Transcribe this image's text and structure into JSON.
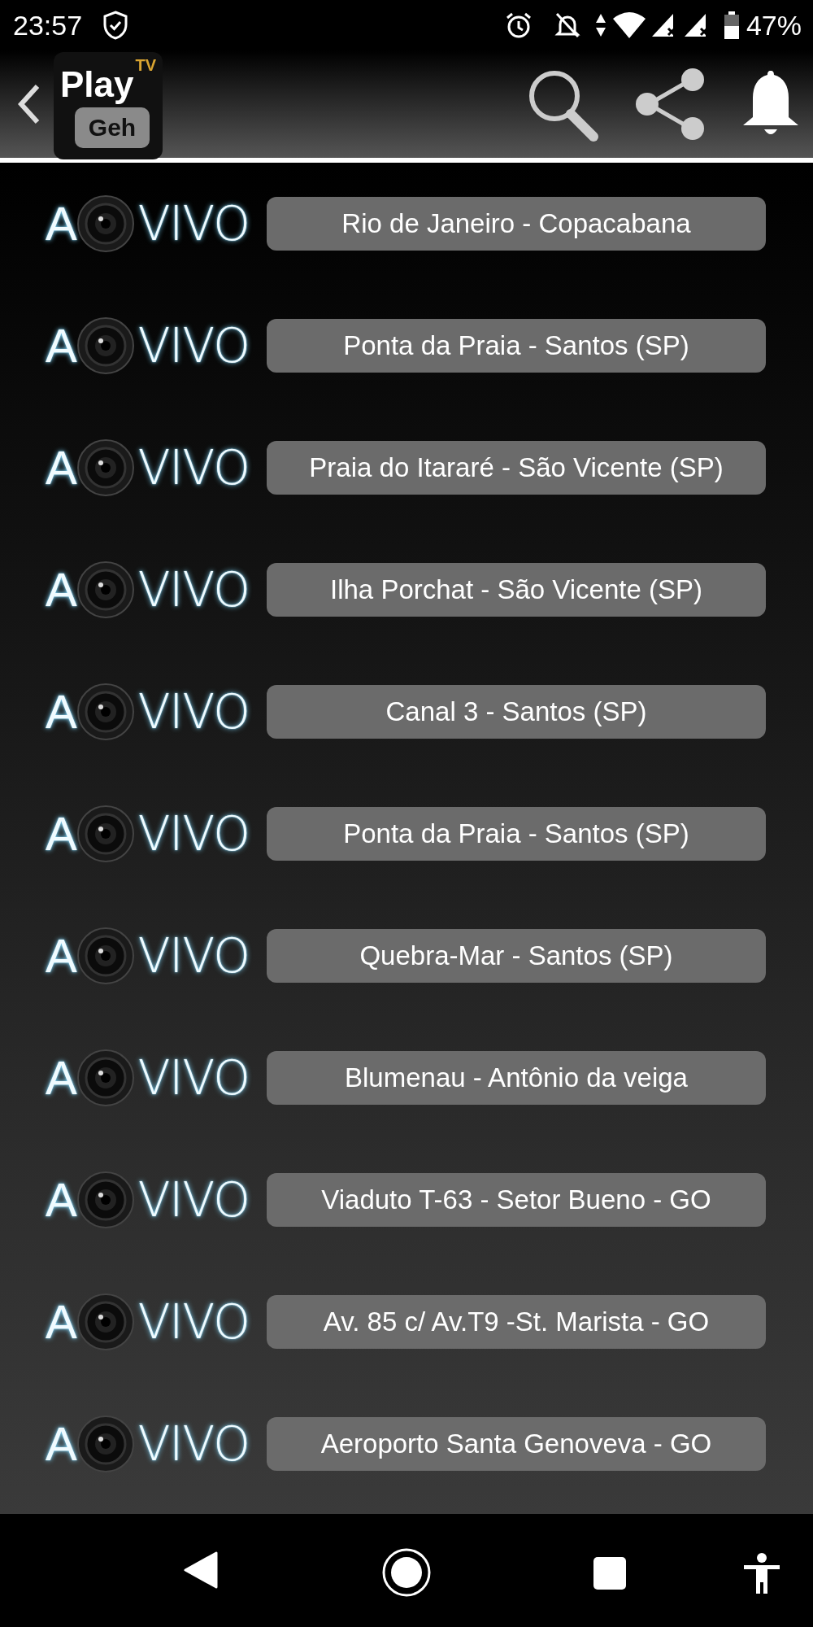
{
  "status_bar": {
    "time": "23:57",
    "battery": "47%"
  },
  "header": {
    "logo": {
      "title": "Play",
      "badge": "TV",
      "subtitle": "Geh"
    }
  },
  "streams": [
    {
      "logo_a": "A",
      "logo_vivo": "VIVO",
      "label": "Rio de Janeiro - Copacabana"
    },
    {
      "logo_a": "A",
      "logo_vivo": "VIVO",
      "label": "Ponta da Praia - Santos (SP)"
    },
    {
      "logo_a": "A",
      "logo_vivo": "VIVO",
      "label": "Praia do Itararé - São Vicente (SP)"
    },
    {
      "logo_a": "A",
      "logo_vivo": "VIVO",
      "label": "Ilha Porchat - São Vicente (SP)"
    },
    {
      "logo_a": "A",
      "logo_vivo": "VIVO",
      "label": "Canal 3 - Santos (SP)"
    },
    {
      "logo_a": "A",
      "logo_vivo": "VIVO",
      "label": "Ponta da Praia - Santos (SP)"
    },
    {
      "logo_a": "A",
      "logo_vivo": "VIVO",
      "label": "Quebra-Mar - Santos (SP)"
    },
    {
      "logo_a": "A",
      "logo_vivo": "VIVO",
      "label": "Blumenau - Antônio da veiga"
    },
    {
      "logo_a": "A",
      "logo_vivo": "VIVO",
      "label": "Viaduto T-63 - Setor Bueno - GO"
    },
    {
      "logo_a": "A",
      "logo_vivo": "VIVO",
      "label": "Av. 85 c/ Av.T9 -St. Marista - GO"
    },
    {
      "logo_a": "A",
      "logo_vivo": "VIVO",
      "label": "Aeroporto Santa Genoveva - GO"
    }
  ]
}
